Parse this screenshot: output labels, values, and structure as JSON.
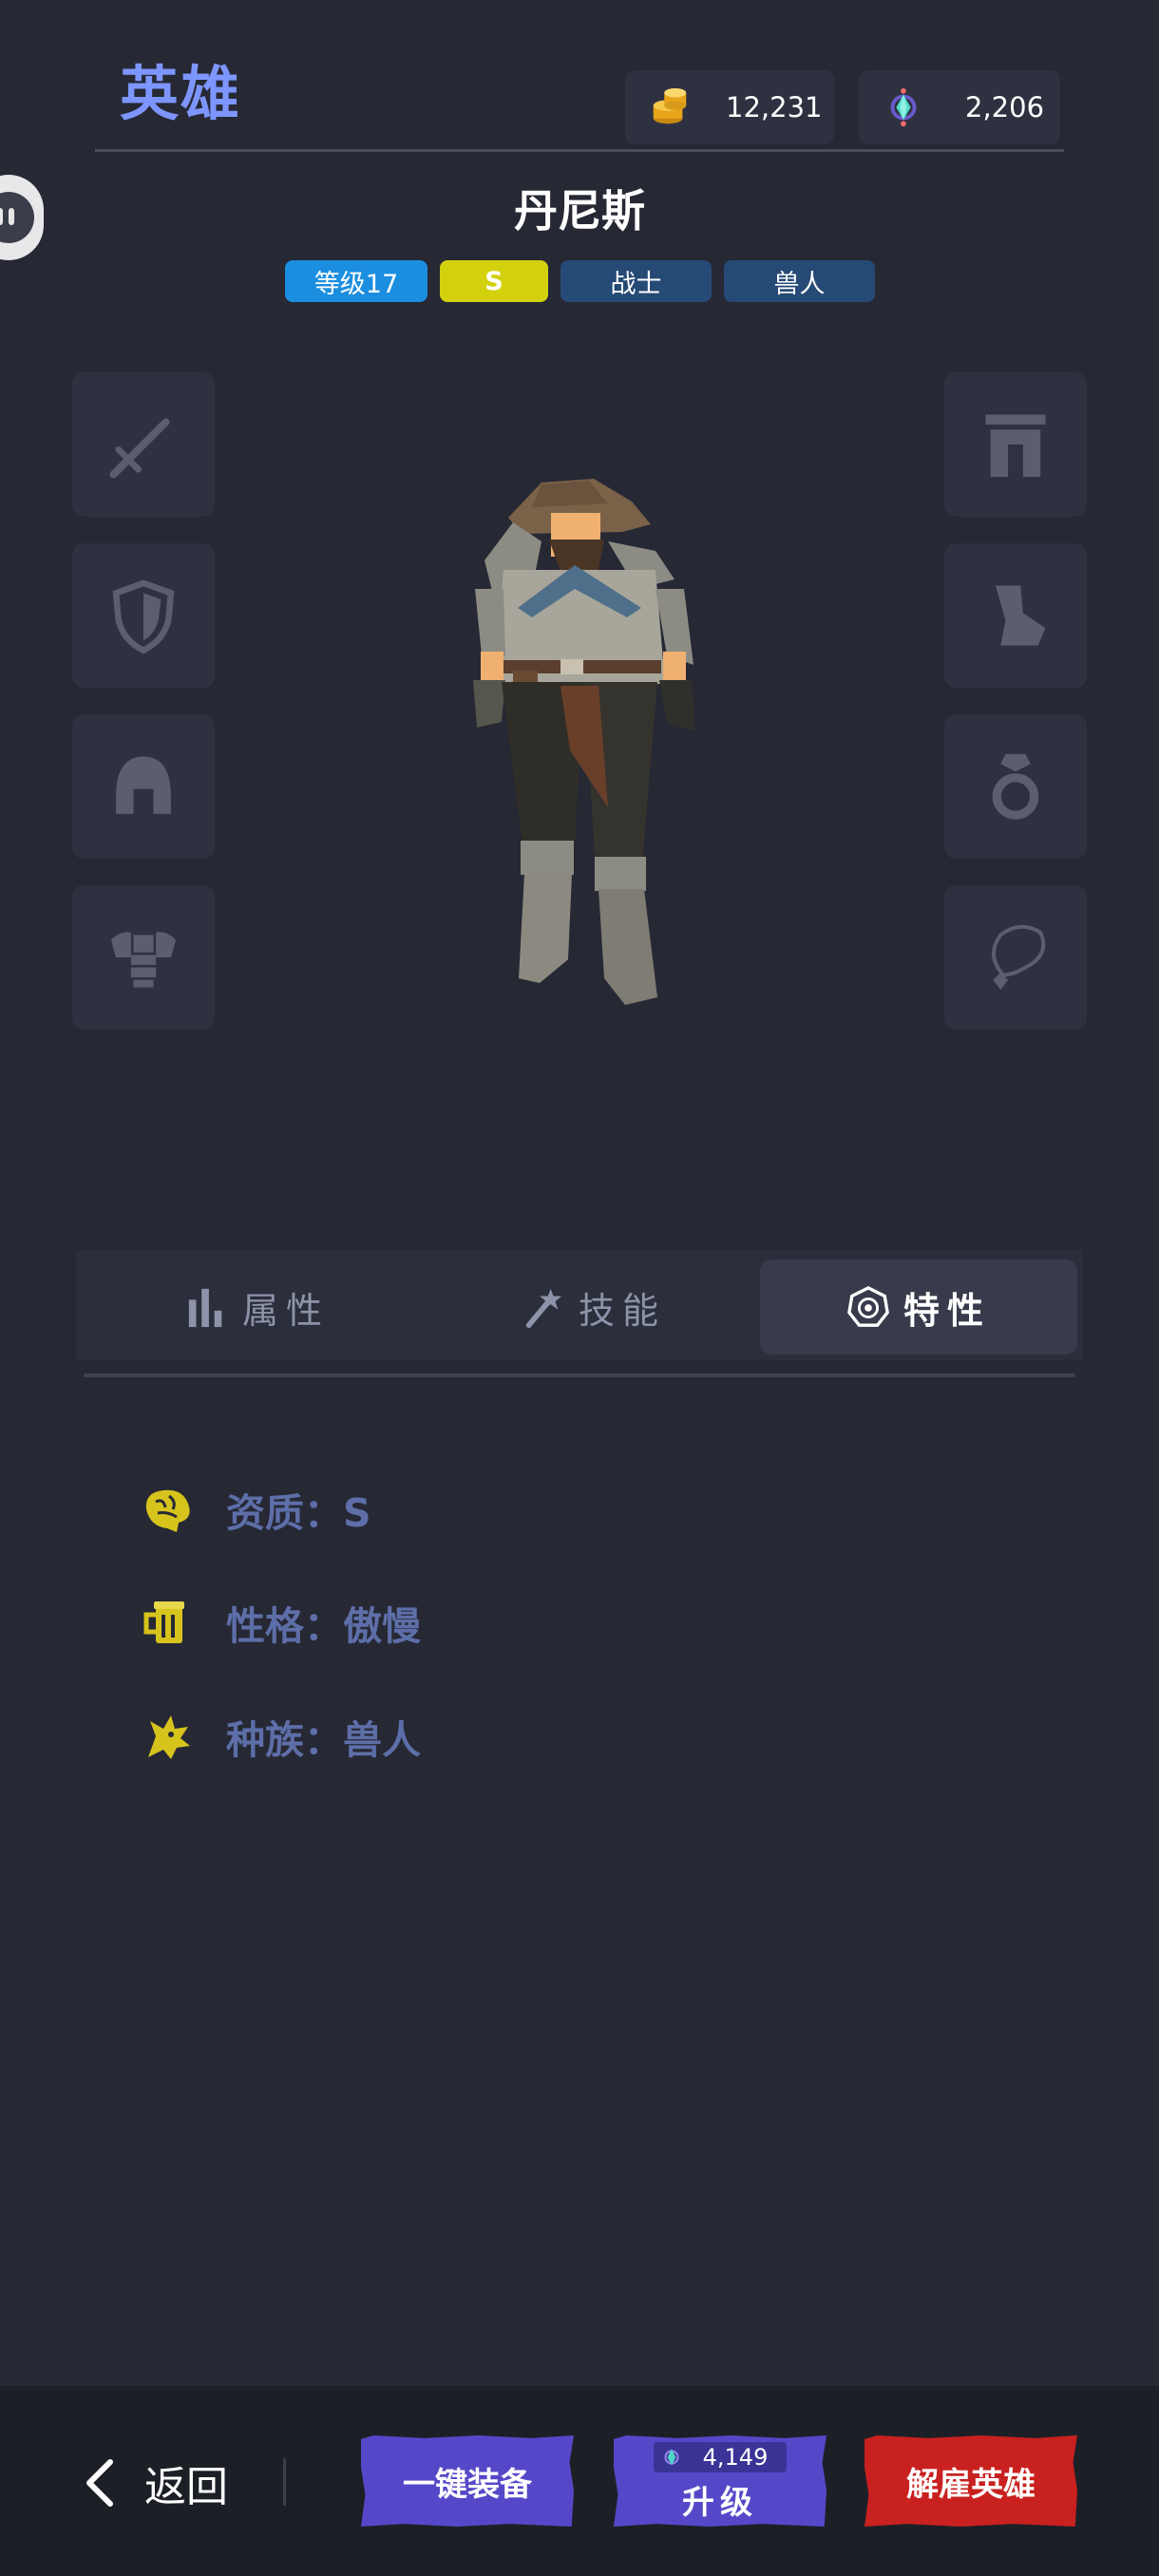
{
  "header": {
    "title": "英雄",
    "gold": "12,231",
    "gems": "2,206"
  },
  "hero": {
    "name": "丹尼斯",
    "tags": {
      "level": "等级17",
      "grade": "S",
      "class": "战士",
      "race": "兽人"
    }
  },
  "equipment_slots": {
    "left": [
      "sword-icon",
      "shield-icon",
      "helmet-icon",
      "armor-icon"
    ],
    "right": [
      "pants-icon",
      "boots-icon",
      "ring-icon",
      "necklace-icon"
    ]
  },
  "tabs": {
    "attributes": "属性",
    "skills": "技能",
    "traits": "特性",
    "active": "traits"
  },
  "traits": {
    "quality": "资质：S",
    "personality": "性格：傲慢",
    "race": "种族：兽人"
  },
  "bottom": {
    "back": "返回",
    "equip_all": "一键装备",
    "upgrade_cost": "4,149",
    "upgrade": "升级",
    "dismiss": "解雇英雄"
  },
  "colors": {
    "background": "#262834",
    "title_accent": "#7d96ff",
    "level_tag": "#1b8ee0",
    "grade_tag": "#d3d10e",
    "class_tag": "#264a76",
    "trait_text": "#5d6ea8",
    "trait_icon": "#d6c31c",
    "primary_button": "#5548c8",
    "danger_button": "#c8211f"
  }
}
